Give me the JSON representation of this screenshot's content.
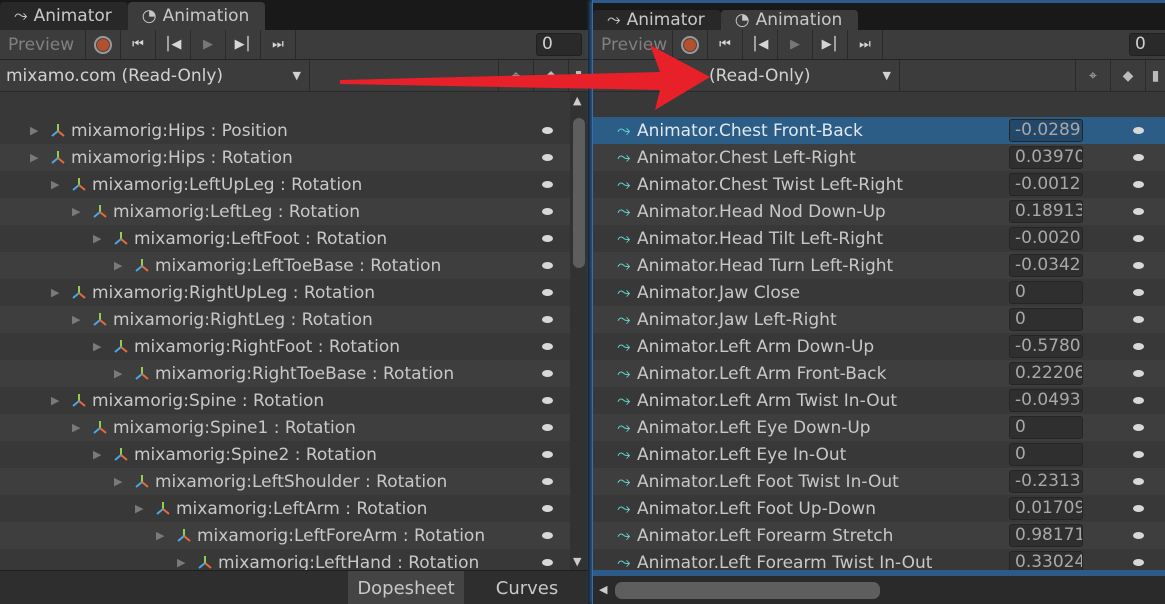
{
  "tabs": [
    {
      "label": "Animator",
      "icon": "animator-icon"
    },
    {
      "label": "Animation",
      "icon": "clock-icon"
    }
  ],
  "toolbar": {
    "preview": "Preview",
    "frame": "0",
    "buttons": [
      "record",
      "first-key",
      "prev-key",
      "play",
      "next-key",
      "last-key"
    ]
  },
  "left": {
    "clip": "mixamo.com (Read-Only)",
    "rows": [
      {
        "label": "mixamorig:Hips : Position",
        "indent": 0
      },
      {
        "label": "mixamorig:Hips : Rotation",
        "indent": 0
      },
      {
        "label": "mixamorig:LeftUpLeg : Rotation",
        "indent": 1
      },
      {
        "label": "mixamorig:LeftLeg : Rotation",
        "indent": 2
      },
      {
        "label": "mixamorig:LeftFoot : Rotation",
        "indent": 3
      },
      {
        "label": "mixamorig:LeftToeBase : Rotation",
        "indent": 4
      },
      {
        "label": "mixamorig:RightUpLeg : Rotation",
        "indent": 1
      },
      {
        "label": "mixamorig:RightLeg : Rotation",
        "indent": 2
      },
      {
        "label": "mixamorig:RightFoot : Rotation",
        "indent": 3
      },
      {
        "label": "mixamorig:RightToeBase : Rotation",
        "indent": 4
      },
      {
        "label": "mixamorig:Spine : Rotation",
        "indent": 1
      },
      {
        "label": "mixamorig:Spine1 : Rotation",
        "indent": 2
      },
      {
        "label": "mixamorig:Spine2 : Rotation",
        "indent": 3
      },
      {
        "label": "mixamorig:LeftShoulder : Rotation",
        "indent": 4
      },
      {
        "label": "mixamorig:LeftArm : Rotation",
        "indent": 5
      },
      {
        "label": "mixamorig:LeftForeArm : Rotation",
        "indent": 6
      },
      {
        "label": "mixamorig:LeftHand : Rotation",
        "indent": 7
      }
    ],
    "bottom_tabs": [
      "Dopesheet",
      "Curves"
    ]
  },
  "right": {
    "clip": "(Read-Only)",
    "rows": [
      {
        "label": "Animator.Chest Front-Back",
        "value": "-0.0289"
      },
      {
        "label": "Animator.Chest Left-Right",
        "value": "0.03970"
      },
      {
        "label": "Animator.Chest Twist Left-Right",
        "value": "-0.0012"
      },
      {
        "label": "Animator.Head Nod Down-Up",
        "value": "0.18913"
      },
      {
        "label": "Animator.Head Tilt Left-Right",
        "value": "-0.0020"
      },
      {
        "label": "Animator.Head Turn Left-Right",
        "value": "-0.0342"
      },
      {
        "label": "Animator.Jaw Close",
        "value": "0"
      },
      {
        "label": "Animator.Jaw Left-Right",
        "value": "0"
      },
      {
        "label": "Animator.Left Arm Down-Up",
        "value": "-0.5780"
      },
      {
        "label": "Animator.Left Arm Front-Back",
        "value": "0.22206"
      },
      {
        "label": "Animator.Left Arm Twist In-Out",
        "value": "-0.0493"
      },
      {
        "label": "Animator.Left Eye Down-Up",
        "value": "0"
      },
      {
        "label": "Animator.Left Eye In-Out",
        "value": "0"
      },
      {
        "label": "Animator.Left Foot Twist In-Out",
        "value": "-0.2313"
      },
      {
        "label": "Animator.Left Foot Up-Down",
        "value": "0.01709"
      },
      {
        "label": "Animator.Left Forearm Stretch",
        "value": "0.98171"
      },
      {
        "label": "Animator.Left Forearm Twist In-Out",
        "value": "0.33024"
      }
    ],
    "selected_row": 0
  },
  "annotation": {
    "arrow_color": "#e8202a"
  },
  "colors": {
    "selection": "#2c5d87",
    "record": "#b5502f"
  }
}
